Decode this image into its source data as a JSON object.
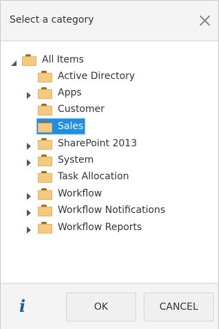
{
  "dialog": {
    "title": "Select a category",
    "close_icon": "close-icon"
  },
  "tree": {
    "root": {
      "label": "All Items",
      "expanded": true
    },
    "items": [
      {
        "label": "Active Directory",
        "has_children": false,
        "selected": false
      },
      {
        "label": "Apps",
        "has_children": true,
        "selected": false
      },
      {
        "label": "Customer",
        "has_children": false,
        "selected": false
      },
      {
        "label": "Sales",
        "has_children": false,
        "selected": true
      },
      {
        "label": "SharePoint 2013",
        "has_children": true,
        "selected": false
      },
      {
        "label": "System",
        "has_children": true,
        "selected": false
      },
      {
        "label": "Task Allocation",
        "has_children": false,
        "selected": false
      },
      {
        "label": "Workflow",
        "has_children": true,
        "selected": false
      },
      {
        "label": "Workflow Notifications",
        "has_children": true,
        "selected": false
      },
      {
        "label": "Workflow Reports",
        "has_children": true,
        "selected": false
      }
    ]
  },
  "footer": {
    "info_icon": "info-icon",
    "info_glyph": "i",
    "ok_label": "OK",
    "cancel_label": "CANCEL"
  },
  "colors": {
    "selection": "#1e8fe6",
    "folder": "#f5ca7f",
    "info": "#1d5ba8"
  }
}
